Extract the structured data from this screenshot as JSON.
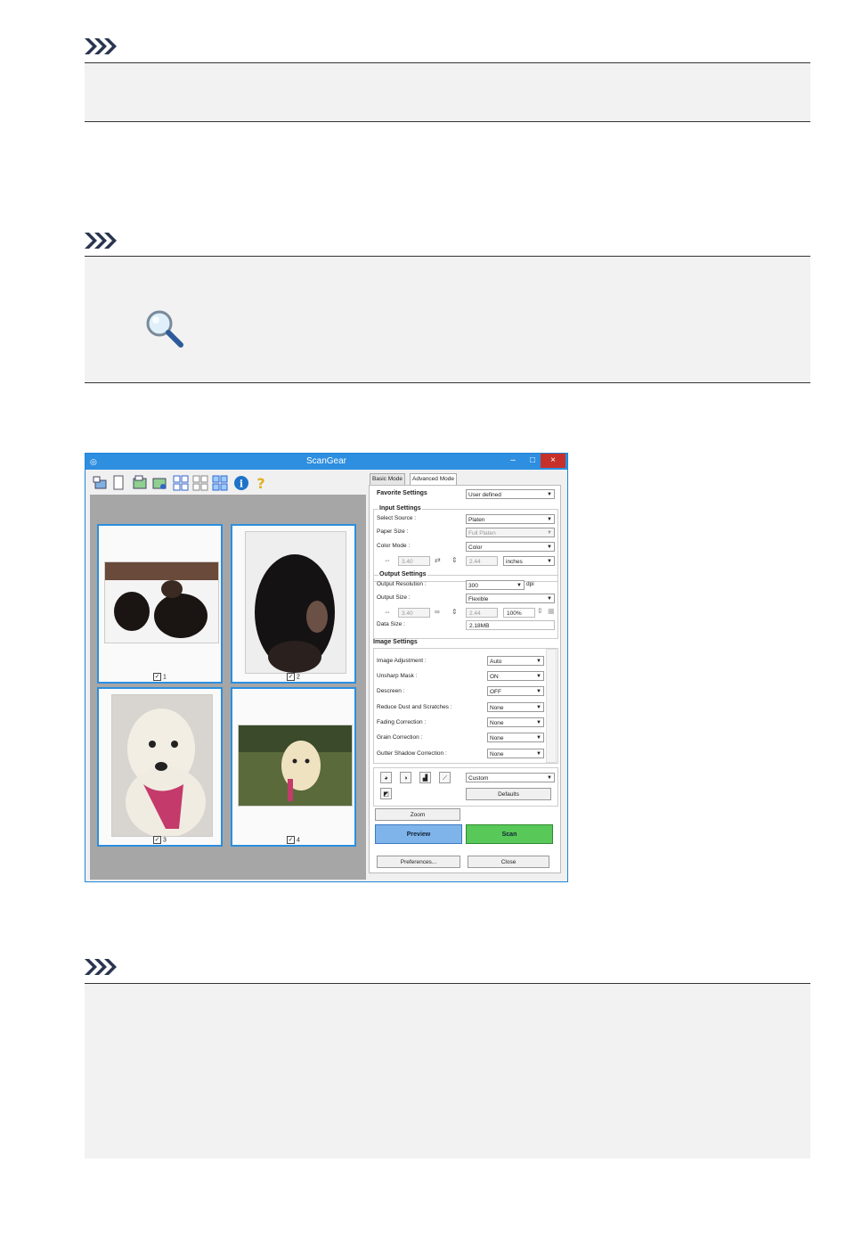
{
  "window": {
    "title": "ScanGear",
    "minimize": "–",
    "maximize": "□",
    "close": "×"
  },
  "thumbnails": [
    {
      "num": "1",
      "checked": true
    },
    {
      "num": "2",
      "checked": true
    },
    {
      "num": "3",
      "checked": true
    },
    {
      "num": "4",
      "checked": true
    }
  ],
  "tabs": {
    "basic": "Basic Mode",
    "advanced": "Advanced Mode"
  },
  "favorite": {
    "label": "Favorite Settings",
    "value": "User defined"
  },
  "input_settings": {
    "title": "Input Settings",
    "select_source_label": "Select Source :",
    "select_source_value": "Platen",
    "paper_size_label": "Paper Size :",
    "paper_size_value": "Full Platen",
    "color_mode_label": "Color Mode :",
    "color_mode_value": "Color",
    "width": "3.40",
    "height": "2.44",
    "unit": "inches"
  },
  "output_settings": {
    "title": "Output Settings",
    "resolution_label": "Output Resolution :",
    "resolution_value": "300",
    "dpi": "dpi",
    "size_label": "Output Size :",
    "size_value": "Flexible",
    "width": "3.40",
    "height": "2.44",
    "scale": "100%",
    "data_size_label": "Data Size :",
    "data_size_value": "2.18MB"
  },
  "image_settings": {
    "title": "Image Settings",
    "rows": [
      {
        "label": "Image Adjustment :",
        "value": "Auto"
      },
      {
        "label": "Unsharp Mask :",
        "value": "ON"
      },
      {
        "label": "Descreen :",
        "value": "OFF"
      },
      {
        "label": "Reduce Dust and Scratches :",
        "value": "None"
      },
      {
        "label": "Fading Correction :",
        "value": "None"
      },
      {
        "label": "Grain Correction :",
        "value": "None"
      },
      {
        "label": "Gutter Shadow Correction :",
        "value": "None"
      }
    ]
  },
  "tone": {
    "preset": "Custom",
    "defaults": "Defaults"
  },
  "buttons": {
    "zoom": "Zoom",
    "preview": "Preview",
    "scan": "Scan",
    "preferences": "Preferences...",
    "close": "Close"
  },
  "colors": {
    "titlebar": "#2e8ee0",
    "selection": "#2b8fdf",
    "preview": "#7fb4ea",
    "scan": "#58c858"
  }
}
